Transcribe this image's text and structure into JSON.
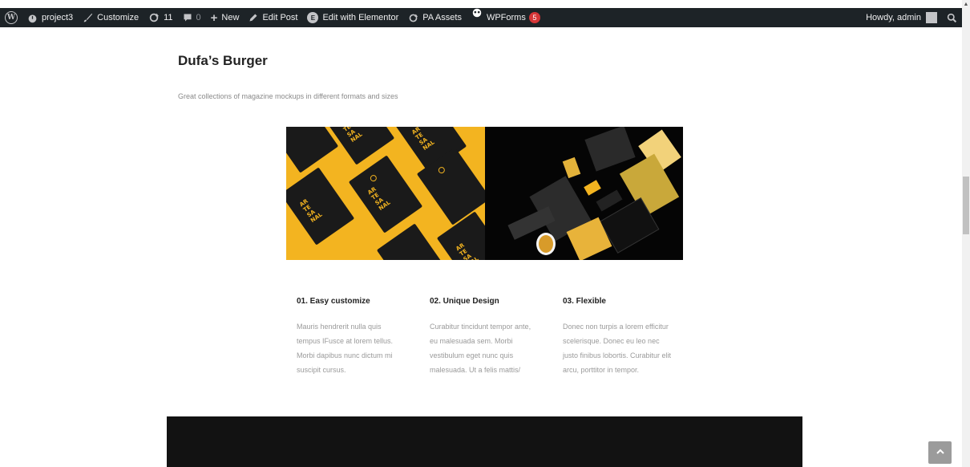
{
  "adminbar": {
    "site_name": "project3",
    "customize": "Customize",
    "updates_count": "11",
    "comments_count": "0",
    "new_label": "New",
    "edit_post": "Edit Post",
    "edit_elementor": "Edit with Elementor",
    "pa_assets": "PA Assets",
    "wpforms": "WPForms",
    "wpforms_badge": "5",
    "howdy": "Howdy, admin",
    "icons": [
      "wordpress-logo-icon",
      "dashboard-icon",
      "brush-icon",
      "refresh-icon",
      "comment-icon",
      "plus-icon",
      "pencil-icon",
      "elementor-icon",
      "pa-icon",
      "wpforms-icon",
      "search-icon"
    ]
  },
  "main": {
    "title": "Dufa’s Burger",
    "subtitle": "Great collections of magazine mockups in different formats and sizes",
    "bag_text": "AR\nTE\nSA\nNAL",
    "colors": {
      "brand_yellow": "#f3b420",
      "dark": "#121212",
      "accent_red": "#d63638"
    }
  },
  "features": [
    {
      "title": "01. Easy customize",
      "text": "Mauris hendrerit nulla quis tempus IFusce at lorem tellus. Morbi dapibus nunc dictum mi suscipit cursus."
    },
    {
      "title": "02. Unique Design",
      "text": "Curabitur tincidunt tempor ante, eu malesuada sem. Morbi vestibulum eget nunc quis malesuada. Ut a felis mattis/"
    },
    {
      "title": "03. Flexible",
      "text": "Donec non turpis a lorem efficitur scelerisque. Donec eu leo nec justo finibus lobortis. Curabitur elit arcu, porttitor in tempor."
    }
  ],
  "back_to_top_icon": "chevron-up-icon"
}
